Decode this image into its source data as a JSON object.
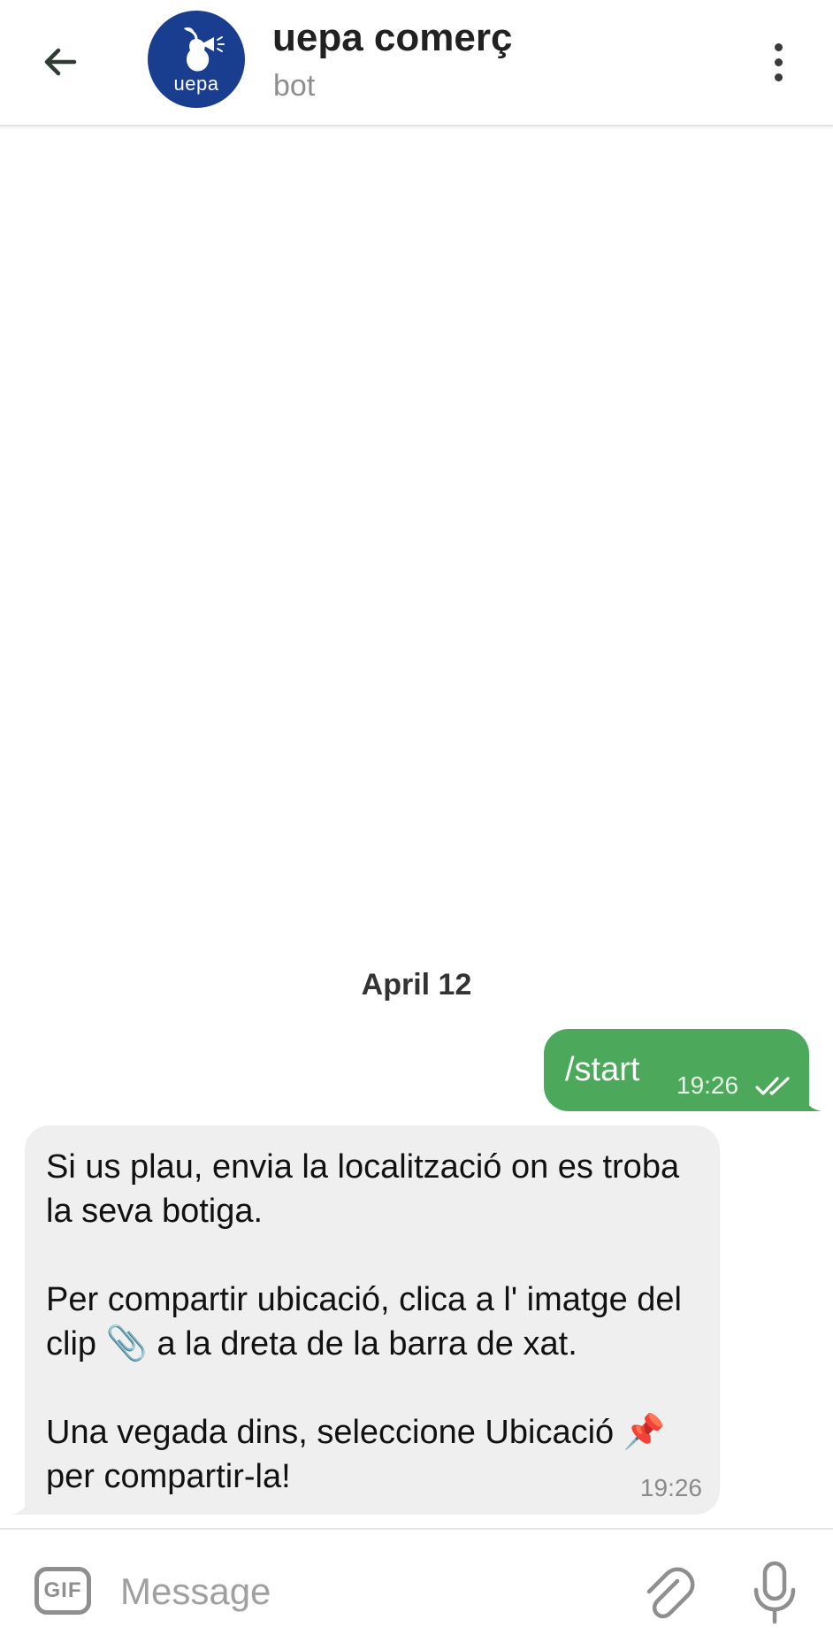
{
  "header": {
    "title": "uepa comerç",
    "subtitle": "bot",
    "avatar_text": "uepa",
    "avatar_color": "#1a3e8f"
  },
  "chat": {
    "date_separator": "April 12",
    "outgoing": {
      "text": "/start",
      "time": "19:26",
      "status": "read",
      "bubble_color": "#4ca95b"
    },
    "incoming": {
      "paragraph_1": "Si us plau, envia la localització on es troba la seva botiga.",
      "paragraph_2": "Per compartir ubicació, clica a l' imatge del clip 📎 a la dreta de la barra de xat.",
      "paragraph_3": "Una vegada dins, seleccione Ubicació 📌 per compartir-la!",
      "time": "19:26",
      "bubble_color": "#efefef"
    }
  },
  "input_bar": {
    "gif_label": "GIF",
    "placeholder": "Message",
    "value": ""
  },
  "icons": {
    "back": "arrow-left-icon",
    "menu": "more-vertical-icon",
    "attach": "paperclip-icon",
    "mic": "microphone-icon",
    "read": "double-check-icon"
  }
}
